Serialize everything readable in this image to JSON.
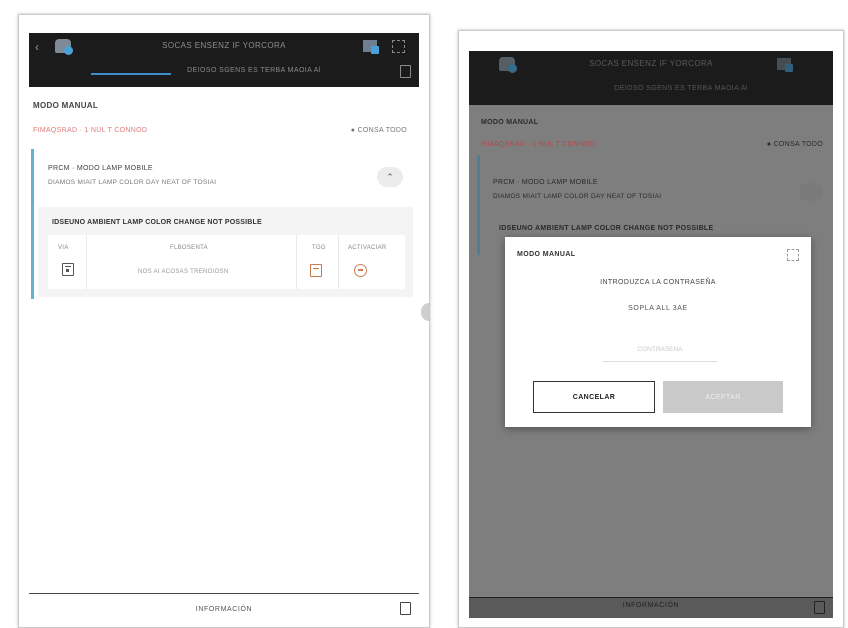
{
  "left": {
    "topbar": {
      "title": "SOCAS ENSENZ IF YORCORA",
      "subtitle": "DEIOSO SGENS ES TERBA MAOIA Al",
      "back_glyph": "‹"
    },
    "section_title": "MODO MANUAL",
    "meta_left": "FIMAQSRAD · 1 NUL T CONNOD",
    "meta_right": "● CONSA TODO",
    "card": {
      "head1": "PRCM · MODO LAMP MOBILE",
      "head2": "DIAMOS MIAIT LAMP COLOR DAY NEAT OF TOSIAI",
      "collapse_glyph": "⌃",
      "sub_title": "IDSEUNO AMBIENT LAMP COLOR CHANGE NOT POSSIBLE",
      "table": {
        "headers": [
          "VIA",
          "FLBOSENTA",
          "TGG",
          "ACTIVACIAR"
        ],
        "row": [
          "",
          "NOS AI ACOSAS TRENOIOSN",
          "",
          ""
        ]
      }
    },
    "bottom_label": "INFORMACIÓN"
  },
  "right": {
    "topbar": {
      "title": "SOCAS ENSENZ IF YORCORA",
      "subtitle": "DEIOSO SGENS ES TERBA MAOIA Al"
    },
    "section_title": "MODO MANUAL",
    "meta_left": "FIMAQSRAD · 1 NUL T CONNOD",
    "meta_right": "● CONSA TODO",
    "card_head1": "PRCM · MODO LAMP MOBILE",
    "card_head2": "DIAMOS MIAIT LAMP COLOR DAY NEAT OF TOSIAI",
    "card_sub": "IDSEUNO AMBIENT LAMP COLOR CHANGE NOT POSSIBLE",
    "bottom_label": "INFORMACIÓN",
    "modal": {
      "title": "MODO MANUAL",
      "prompt": "INTRODUZCA LA CONTRASEÑA",
      "code": "SOPLA ALL 3AE",
      "input_value": "",
      "input_placeholder": "CONTRASEÑA",
      "cancel_label": "CANCELAR",
      "accept_label": "ACEPTAR"
    }
  }
}
